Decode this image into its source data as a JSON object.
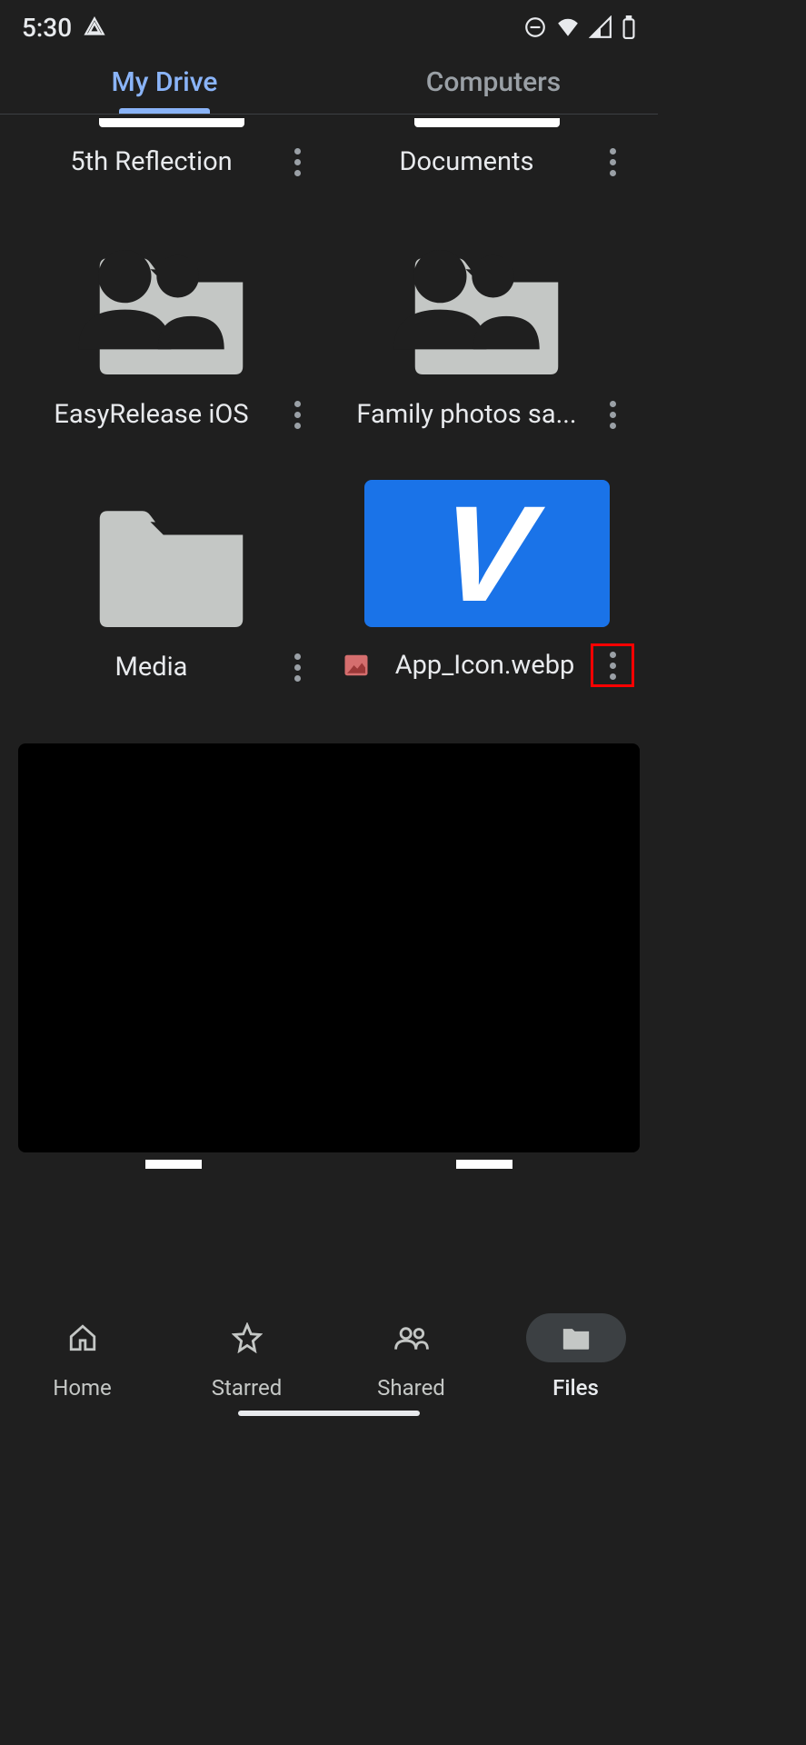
{
  "status": {
    "time": "5:30"
  },
  "tabs": {
    "drive": "My Drive",
    "computers": "Computers"
  },
  "items": {
    "reflection": "5th Reflection",
    "documents": "Documents",
    "easyrelease": "EasyRelease iOS",
    "family": "Family photos sa...",
    "media": "Media",
    "appicon": "App_Icon.webp"
  },
  "nav": {
    "home": "Home",
    "starred": "Starred",
    "shared": "Shared",
    "files": "Files"
  }
}
